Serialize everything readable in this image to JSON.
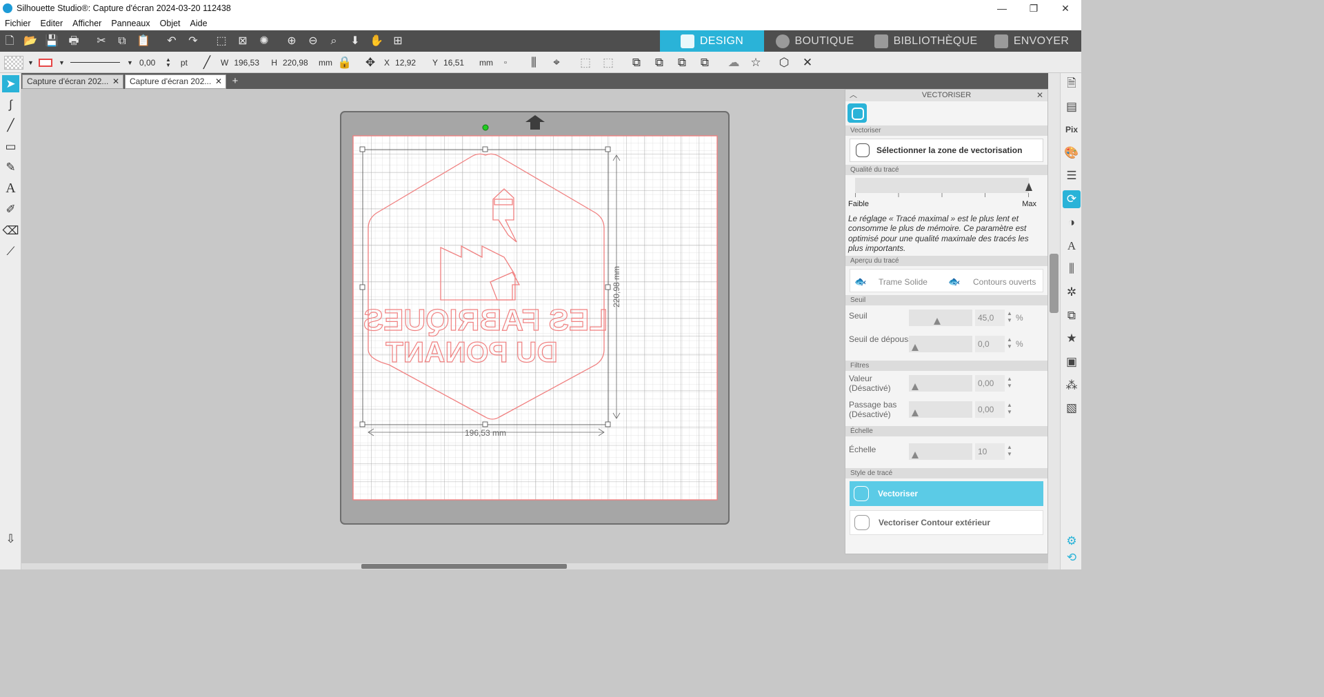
{
  "window": {
    "title": "Silhouette Studio®: Capture d'écran 2024-03-20 112438",
    "minimize": "—",
    "maximize": "❐",
    "close": "✕"
  },
  "menu": [
    "Fichier",
    "Editer",
    "Afficher",
    "Panneaux",
    "Objet",
    "Aide"
  ],
  "nav_tabs": [
    {
      "label": "DESIGN",
      "active": true
    },
    {
      "label": "BOUTIQUE",
      "active": false
    },
    {
      "label": "BIBLIOTHÈQUE",
      "active": false
    },
    {
      "label": "ENVOYER",
      "active": false
    }
  ],
  "toolbar2": {
    "line_width": "0,00",
    "line_unit": "pt",
    "w_label": "W",
    "w_value": "196,53",
    "h_label": "H",
    "h_value": "220,98",
    "size_unit": "mm",
    "x_label": "X",
    "x_value": "12,92",
    "y_label": "Y",
    "y_value": "16,51",
    "pos_unit": "mm"
  },
  "doc_tabs": [
    {
      "label": "Capture d'écran 202...",
      "active": false
    },
    {
      "label": "Capture d'écran 202...",
      "active": true
    }
  ],
  "canvas": {
    "width_dim": "196,53 mm",
    "height_dim": "220,98 mm",
    "design_text_line1": "LES FABRIQUES",
    "design_text_line2": "DU PONANT"
  },
  "panel": {
    "title": "VECTORISER",
    "section_vectoriser": "Vectoriser",
    "select_zone_btn": "Sélectionner la zone de vectorisation",
    "section_quality": "Qualité du tracé",
    "quality_min": "Faible",
    "quality_max": "Max",
    "quality_level": 1.0,
    "note": "Le réglage « Tracé maximal » est le plus lent et consomme le plus de mémoire. Ce paramètre est optimisé pour une qualité maximale des tracés les plus importants.",
    "section_apercu": "Aperçu du tracé",
    "trame_solide": "Trame Solide",
    "contours_ouverts": "Contours ouverts",
    "section_seuil": "Seuil",
    "seuil_label": "Seuil",
    "seuil_value": "45,0",
    "seuil_unit": "%",
    "depous_label": "Seuil de dépoussiérage",
    "depous_value": "0,0",
    "depous_unit": "%",
    "section_filtres": "Filtres",
    "valeur_label": "Valeur (Désactivé)",
    "valeur_value": "0,00",
    "passage_label": "Passage bas (Désactivé)",
    "passage_value": "0,00",
    "section_echelle": "Échelle",
    "echelle_label": "Échelle",
    "echelle_value": "10",
    "section_style": "Style de tracé",
    "vectoriser_btn": "Vectoriser",
    "vectoriser_contour_btn": "Vectoriser Contour extérieur"
  },
  "colors": {
    "accent": "#2ab3d8",
    "cut_line": "#f08080",
    "toolbar_dark": "#4e4e4e"
  }
}
